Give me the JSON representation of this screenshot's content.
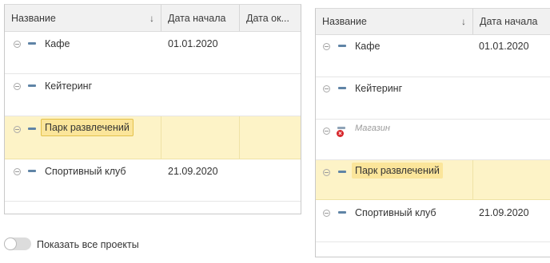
{
  "left_table": {
    "headers": [
      "Название",
      "Дата начала",
      "Дата ок..."
    ],
    "sort_arrow": "↓",
    "rows": [
      {
        "name": "Кафе",
        "start_date": "01.01.2020",
        "end_date": ""
      },
      {
        "name": "Кейтеринг",
        "start_date": "",
        "end_date": ""
      },
      {
        "name": "Парк развлечений",
        "start_date": "",
        "end_date": "",
        "highlighted": true,
        "selected": true
      },
      {
        "name": "Спортивный клуб",
        "start_date": "21.09.2020",
        "end_date": ""
      }
    ]
  },
  "right_table": {
    "headers": [
      "Название",
      "Дата начала"
    ],
    "sort_arrow": "↓",
    "rows": [
      {
        "name": "Кафе",
        "start_date": "01.01.2020"
      },
      {
        "name": "Кейтеринг",
        "start_date": ""
      },
      {
        "name": "Магазин",
        "start_date": "",
        "status": "error",
        "muted": true
      },
      {
        "name": "Парк развлечений",
        "start_date": "",
        "highlighted": true
      },
      {
        "name": "Спортивный клуб",
        "start_date": "21.09.2020"
      }
    ]
  },
  "show_all_toggle": {
    "label": "Показать все проекты",
    "on": false
  },
  "colors": {
    "highlight_row": "#fdf3c7",
    "highlight_badge": "#fbe59a",
    "row_icon": "#5f84a6",
    "error_icon": "#d7262b"
  }
}
